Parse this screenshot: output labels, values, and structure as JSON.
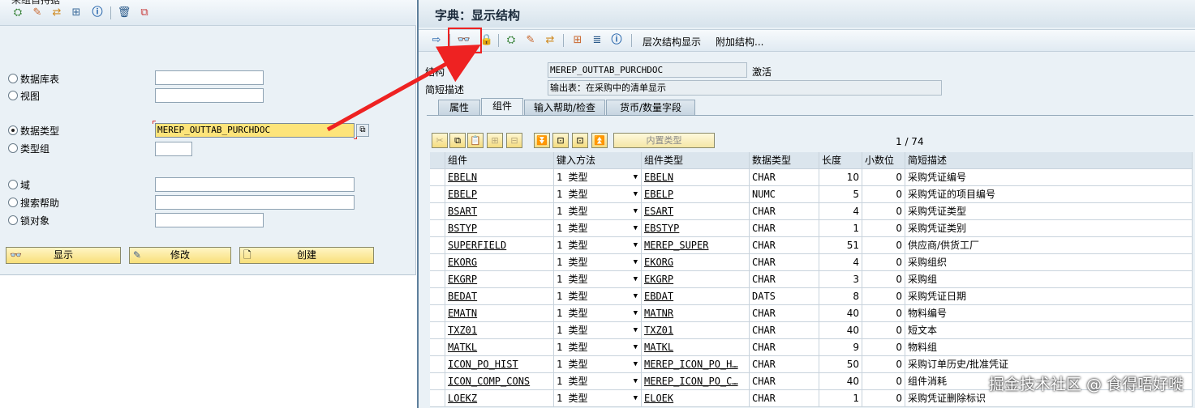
{
  "left": {
    "title_partial": "来组自捋据",
    "radios": [
      {
        "label": "数据库表",
        "value": "",
        "checked": false
      },
      {
        "label": "视图",
        "value": "",
        "checked": false
      },
      {
        "label": "数据类型",
        "value": "MEREP_OUTTAB_PURCHDOC",
        "checked": true
      },
      {
        "label": "类型组",
        "value": "",
        "checked": false
      },
      {
        "label": "域",
        "value": "",
        "checked": false
      },
      {
        "label": "搜索帮助",
        "value": "",
        "checked": false
      },
      {
        "label": "锁对象",
        "value": "",
        "checked": false
      }
    ],
    "buttons": {
      "display": "显示",
      "change": "修改",
      "create": "创建"
    }
  },
  "right": {
    "title": "字典：显示结构",
    "toolbar": {
      "hierarchy": "层次结构显示",
      "append": "附加结构..."
    },
    "structure_label": "结构",
    "structure_value": "MEREP_OUTTAB_PURCHDOC",
    "status": "激活",
    "desc_label": "简短描述",
    "desc_value": "输出表：在采购中的清单显示",
    "tabs": [
      "属性",
      "组件",
      "输入帮助/检查",
      "货币/数量字段"
    ],
    "active_tab": 1,
    "builtin_type": "内置类型",
    "pager": "1 / 74",
    "columns": [
      "组件",
      "键入方法",
      "组件类型",
      "数据类型",
      "长度",
      "小数位",
      "简短描述"
    ],
    "rows": [
      [
        "EBELN",
        "1 类型",
        "EBELN",
        "CHAR",
        "10",
        "0",
        "采购凭证编号"
      ],
      [
        "EBELP",
        "1 类型",
        "EBELP",
        "NUMC",
        "5",
        "0",
        "采购凭证的项目编号"
      ],
      [
        "BSART",
        "1 类型",
        "ESART",
        "CHAR",
        "4",
        "0",
        "采购凭证类型"
      ],
      [
        "BSTYP",
        "1 类型",
        "EBSTYP",
        "CHAR",
        "1",
        "0",
        "采购凭证类别"
      ],
      [
        "SUPERFIELD",
        "1 类型",
        "MEREP_SUPER",
        "CHAR",
        "51",
        "0",
        "供应商/供货工厂"
      ],
      [
        "EKORG",
        "1 类型",
        "EKORG",
        "CHAR",
        "4",
        "0",
        "采购组织"
      ],
      [
        "EKGRP",
        "1 类型",
        "EKGRP",
        "CHAR",
        "3",
        "0",
        "采购组"
      ],
      [
        "BEDAT",
        "1 类型",
        "EBDAT",
        "DATS",
        "8",
        "0",
        "采购凭证日期"
      ],
      [
        "EMATN",
        "1 类型",
        "MATNR",
        "CHAR",
        "40",
        "0",
        "物料编号"
      ],
      [
        "TXZ01",
        "1 类型",
        "TXZ01",
        "CHAR",
        "40",
        "0",
        "短文本"
      ],
      [
        "MATKL",
        "1 类型",
        "MATKL",
        "CHAR",
        "9",
        "0",
        "物料组"
      ],
      [
        "ICON_PO_HIST",
        "1 类型",
        "MEREP_ICON_PO_H…",
        "CHAR",
        "50",
        "0",
        "采购订单历史/批准凭证"
      ],
      [
        "ICON_COMP_CONS",
        "1 类型",
        "MEREP_ICON_PO_C…",
        "CHAR",
        "40",
        "0",
        "组件消耗"
      ],
      [
        "LOEKZ",
        "1 类型",
        "ELOEK",
        "CHAR",
        "1",
        "0",
        "采购凭证删除标识"
      ]
    ]
  },
  "watermark": "掘金技术社区 @ 食得唔好嘥"
}
